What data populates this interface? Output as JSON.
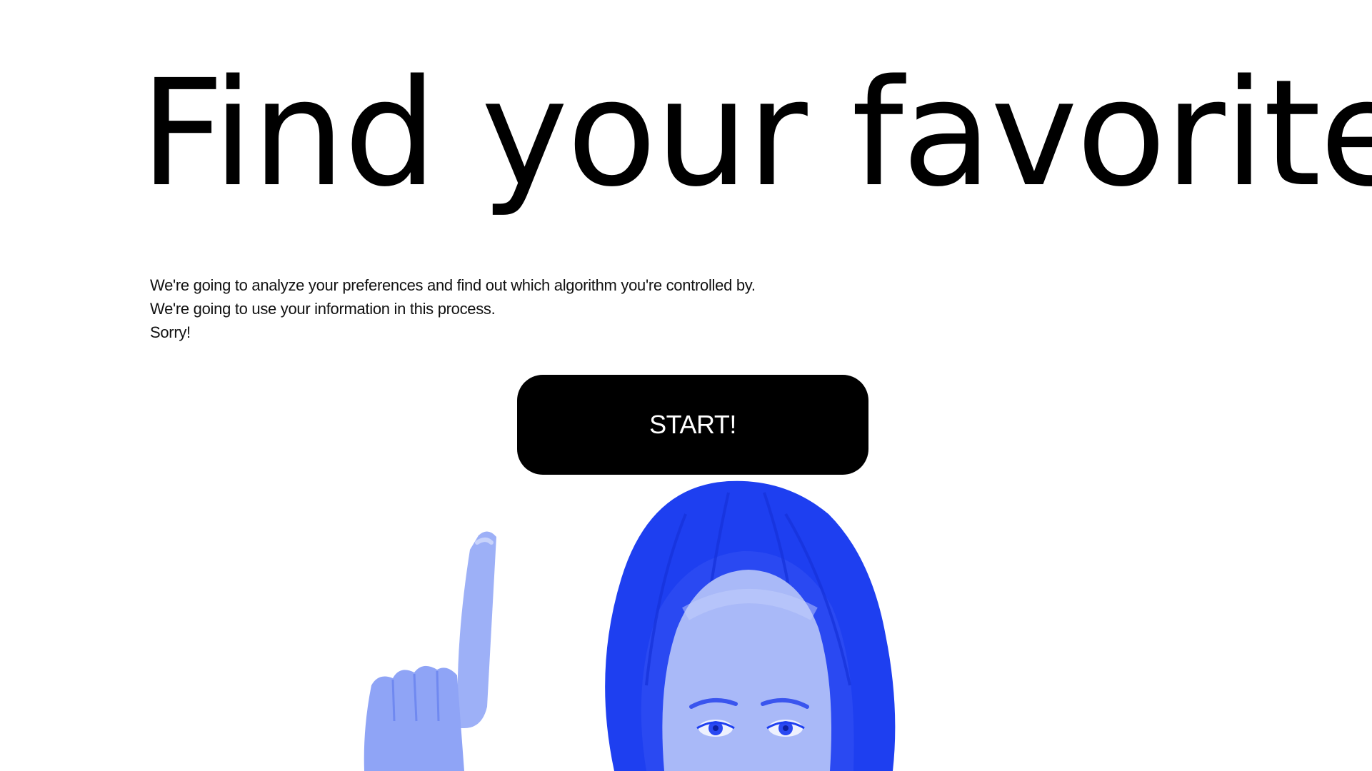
{
  "hero": {
    "headline": "Find your favorite",
    "intro_lines": [
      "We're going to analyze your preferences and find out which algorithm you're controlled by.",
      "We're going to use your information in this process.",
      "Sorry!"
    ],
    "start_label": "START!"
  },
  "theme": {
    "background": "#ffffff",
    "text": "#000000",
    "button_bg": "#000000",
    "button_text": "#ffffff",
    "illustration_blue": "#1e3ff0"
  },
  "illustration": {
    "subject": "woman-pointing-up",
    "tint": "blue-duotone"
  }
}
